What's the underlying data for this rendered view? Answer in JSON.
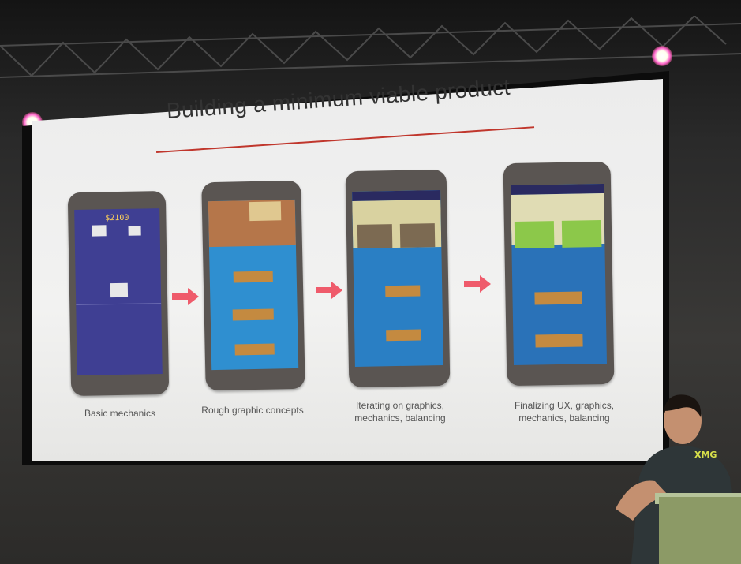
{
  "slide": {
    "title": "Building a minimum viable product",
    "stages": [
      {
        "caption": "Basic mechanics",
        "screen_text": "$2100"
      },
      {
        "caption": "Rough graphic concepts"
      },
      {
        "caption": "Iterating on graphics, mechanics, balancing"
      },
      {
        "caption": "Finalizing UX, graphics, mechanics, balancing"
      }
    ]
  },
  "scene": {
    "presenter_shirt_logo": "XMG"
  },
  "colors": {
    "accent": "#c0362c",
    "arrow": "#ef5b6b",
    "phone1_screen": "#3f3f93",
    "water": "#2f8fd0"
  }
}
